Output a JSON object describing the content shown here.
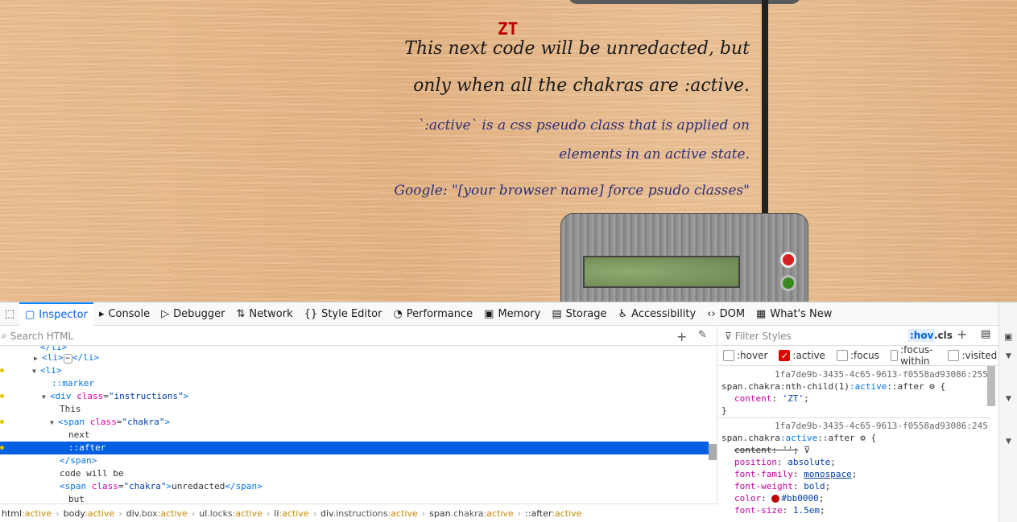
{
  "page": {
    "zt_text": "ZT",
    "line1": "This next code will be unredacted, but",
    "line2": "only when all the chakras are :active.",
    "line3": "`:active` is a css pseudo class that is applied on",
    "line4": "elements in an active state.",
    "line5": "Google: \"[your browser name] force psudo classes\""
  },
  "devtools": {
    "tabs": [
      {
        "label": "Inspector",
        "icon": "inspector-icon",
        "selected": true
      },
      {
        "label": "Console",
        "icon": "console-icon"
      },
      {
        "label": "Debugger",
        "icon": "debugger-icon"
      },
      {
        "label": "Network",
        "icon": "network-icon"
      },
      {
        "label": "Style Editor",
        "icon": "style-editor-icon"
      },
      {
        "label": "Performance",
        "icon": "performance-icon"
      },
      {
        "label": "Memory",
        "icon": "memory-icon"
      },
      {
        "label": "Storage",
        "icon": "storage-icon"
      },
      {
        "label": "Accessibility",
        "icon": "accessibility-icon"
      },
      {
        "label": "DOM",
        "icon": "dom-icon"
      },
      {
        "label": "What's New",
        "icon": "gift-icon"
      }
    ],
    "search_placeholder": "Search HTML",
    "filter_placeholder": "Filter Styles",
    "hov_label": ":hov",
    "cls_label": ".cls",
    "pseudo_classes": [
      {
        "label": ":hover",
        "checked": false
      },
      {
        "label": ":active",
        "checked": true
      },
      {
        "label": ":focus",
        "checked": false
      },
      {
        "label": ":focus-within",
        "checked": false
      },
      {
        "label": ":visited",
        "checked": false
      }
    ],
    "tree": {
      "r0": "</li>",
      "r1_open": "<li>",
      "r1_ellipsis": "⋯",
      "r1_close": "</li>",
      "r2": "<li>",
      "r3": "::marker",
      "r4_tag": "div",
      "r4_attr": "class",
      "r4_val": "\"instructions\"",
      "r5": "This",
      "r6_tag": "span",
      "r6_attr": "class",
      "r6_val": "\"chakra\"",
      "r7": "next",
      "r8": "::after",
      "r9": "</span>",
      "r10": "code will be",
      "r11_tag": "span",
      "r11_attr": "class",
      "r11_val": "\"chakra\"",
      "r11_text": "unredacted",
      "r11_close": "</span>",
      "r12": "but"
    },
    "breadcrumbs": [
      {
        "el": "html",
        "cls": "",
        "ps": ":active"
      },
      {
        "el": "body",
        "cls": "",
        "ps": ":active"
      },
      {
        "el": "div",
        "cls": ".box",
        "ps": ":active"
      },
      {
        "el": "ul",
        "cls": ".locks",
        "ps": ":active"
      },
      {
        "el": "li",
        "cls": "",
        "ps": ":active"
      },
      {
        "el": "div",
        "cls": ".instructions",
        "ps": ":active"
      },
      {
        "el": "span",
        "cls": ".chakra",
        "ps": ":active"
      },
      {
        "el": "::after",
        "cls": "",
        "ps": ":active"
      }
    ],
    "rules": {
      "src1": "1fa7de9b-3435-4c65-9613-f0558ad93086:255",
      "sel1_a": "span.chakra:nth-child(1)",
      "sel1_b": ":active",
      "sel1_c": "::after",
      "p1_name": "content",
      "p1_val": "'ZT'",
      "close1": "}",
      "src2": "1fa7de9b-3435-4c65-9613-f0558ad93086:245",
      "sel2_a": "span.chakra",
      "sel2_b": ":active",
      "sel2_c": "::after",
      "p2_struck": "content: '';",
      "p3_name": "position",
      "p3_val": "absolute",
      "p4_name": "font-family",
      "p4_val": "monospace",
      "p5_name": "font-weight",
      "p5_val": "bold",
      "p6_name": "color",
      "p6_val": "#bb0000",
      "p7_name": "font-size",
      "p7_val": "1.5em"
    }
  },
  "colors": {
    "chakra_color": "#bb0000",
    "accent": "#0060df"
  }
}
